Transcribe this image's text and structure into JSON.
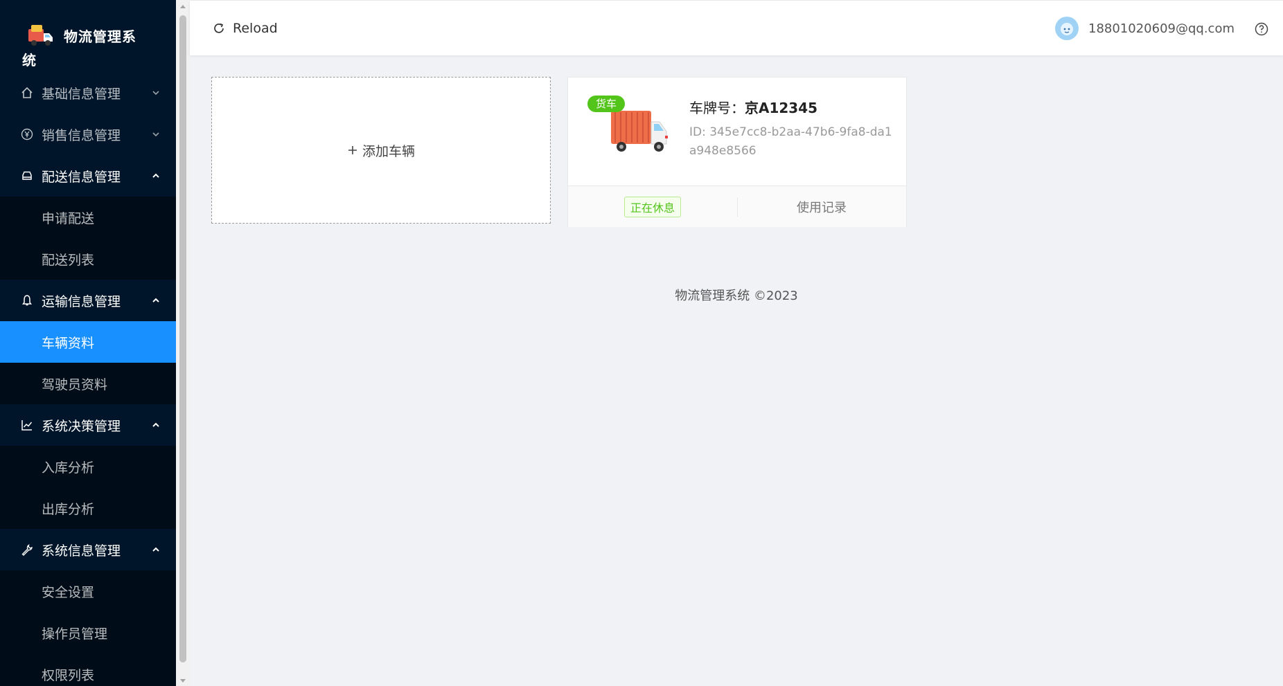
{
  "app": {
    "title": "物流管理系统"
  },
  "sidebar": {
    "menus": [
      {
        "label": "基础信息管理",
        "icon": "home-icon",
        "open": false
      },
      {
        "label": "销售信息管理",
        "icon": "yen-icon",
        "open": false
      },
      {
        "label": "配送信息管理",
        "icon": "car-icon",
        "open": true
      },
      {
        "label": "运输信息管理",
        "icon": "bell-icon",
        "open": true
      },
      {
        "label": "系统决策管理",
        "icon": "line-chart-icon",
        "open": true
      },
      {
        "label": "系统信息管理",
        "icon": "tool-icon",
        "open": true
      }
    ],
    "sub": {
      "delivery": [
        "申请配送",
        "配送列表"
      ],
      "transport": [
        "车辆资料",
        "驾驶员资料"
      ],
      "decision": [
        "入库分析",
        "出库分析"
      ],
      "system": [
        "安全设置",
        "操作员管理",
        "权限列表"
      ]
    },
    "selected": "车辆资料"
  },
  "header": {
    "reload_label": "Reload",
    "user_email": "18801020609@qq.com"
  },
  "content": {
    "add_vehicle_label": "添加车辆",
    "vehicle": {
      "type_tag": "货车",
      "plate_prefix": "车牌号：",
      "plate": "京A12345",
      "id_text": "ID: 345e7cc8-b2aa-47b6-9fa8-da1a948e8566",
      "status": "正在休息",
      "history_label": "使用记录"
    }
  },
  "footer": {
    "text": "物流管理系统 ©2023"
  },
  "colors": {
    "sidebar_bg": "#001529",
    "submenu_bg": "#000c17",
    "selected": "#1890ff",
    "truck_tag": "#52c41a",
    "page_bg": "#f0f2f5"
  }
}
